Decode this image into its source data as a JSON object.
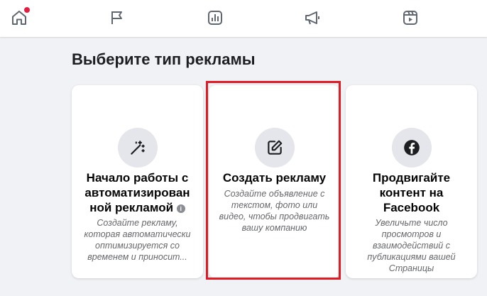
{
  "nav": {
    "items": [
      {
        "icon": "home-icon",
        "notification": true
      },
      {
        "icon": "flag-icon"
      },
      {
        "icon": "insights-icon"
      },
      {
        "icon": "megaphone-icon"
      },
      {
        "icon": "reels-icon"
      }
    ],
    "notification_color": "#e41e3f"
  },
  "page": {
    "title": "Выберите тип рекламы"
  },
  "cards": [
    {
      "icon": "magic-wand-icon",
      "title_line1": "Начало работы с",
      "title_line2": "автоматизирован",
      "title_line3": "ной рекламой",
      "info_icon": "i",
      "description": "Создайте рекламу, которая автоматически оптимизируется со временем и приносит..."
    },
    {
      "icon": "edit-icon",
      "title": "Создать рекламу",
      "description": "Создайте объявление с текстом, фото или видео, чтобы продвигать вашу компанию"
    },
    {
      "icon": "facebook-icon",
      "title": "Продвигайте контент на Facebook",
      "description": "Увеличьте число просмотров и взаимодействий с публикациями вашей Страницы"
    }
  ],
  "colors": {
    "highlight": "#e01b24",
    "background": "#f0f2f5",
    "icon_circle": "#e4e6eb"
  }
}
